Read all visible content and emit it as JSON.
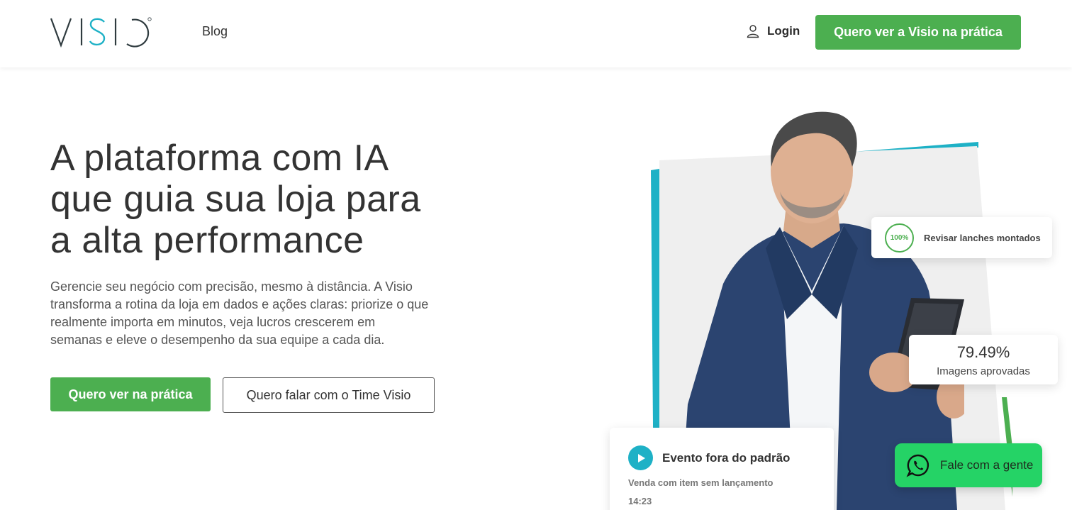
{
  "header": {
    "logo_text": "VISIO",
    "nav": {
      "blog": "Blog"
    },
    "login": "Login",
    "cta": "Quero ver a Visio na prática"
  },
  "hero": {
    "title_lines": [
      "A plataforma com IA",
      "que guia sua loja para",
      "a alta performance"
    ],
    "subtitle_lines": [
      "Gerencie seu negócio com precisão, mesmo à distância. A Visio",
      "transforma a rotina da loja em dados e ações claras: priorize o que",
      "realmente importa em minutos, veja lucros crescerem em",
      "semanas e eleve o desempenho da sua equipe a cada dia."
    ],
    "primary_button": "Quero ver na prática",
    "secondary_button": "Quero falar com o Time Visio"
  },
  "cards": {
    "review": {
      "percent": "100%",
      "label": "Revisar lanches montados"
    },
    "stat": {
      "value": "79.49%",
      "caption": "Imagens aprovadas"
    },
    "event": {
      "title": "Evento fora do padrão",
      "description": "Venda com item sem lançamento",
      "time": "14:23"
    }
  },
  "whatsapp": {
    "label": "Fale com a gente"
  },
  "colors": {
    "brand_green": "#4caf50",
    "accent_teal": "#1eb1c6",
    "whatsapp_green": "#25d366",
    "text_dark": "#333333"
  },
  "icons": {
    "login": "user-icon",
    "event": "play-icon",
    "whatsapp": "whatsapp-icon"
  }
}
